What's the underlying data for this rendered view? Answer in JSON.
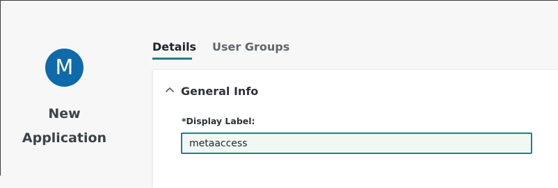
{
  "app": {
    "avatar_letter": "M",
    "name": "New Application"
  },
  "tabs": [
    {
      "label": "Details",
      "active": true
    },
    {
      "label": "User Groups",
      "active": false
    }
  ],
  "section": {
    "title": "General Info",
    "expanded": true
  },
  "fields": {
    "display_label": {
      "label": "*Display Label:",
      "value": "metaaccess"
    }
  },
  "colors": {
    "avatar_bg": "#0e6aa8",
    "accent": "#1f7f86",
    "input_bg": "#f1f8f4"
  },
  "icons": {
    "section_toggle": "chevron-up-icon"
  }
}
